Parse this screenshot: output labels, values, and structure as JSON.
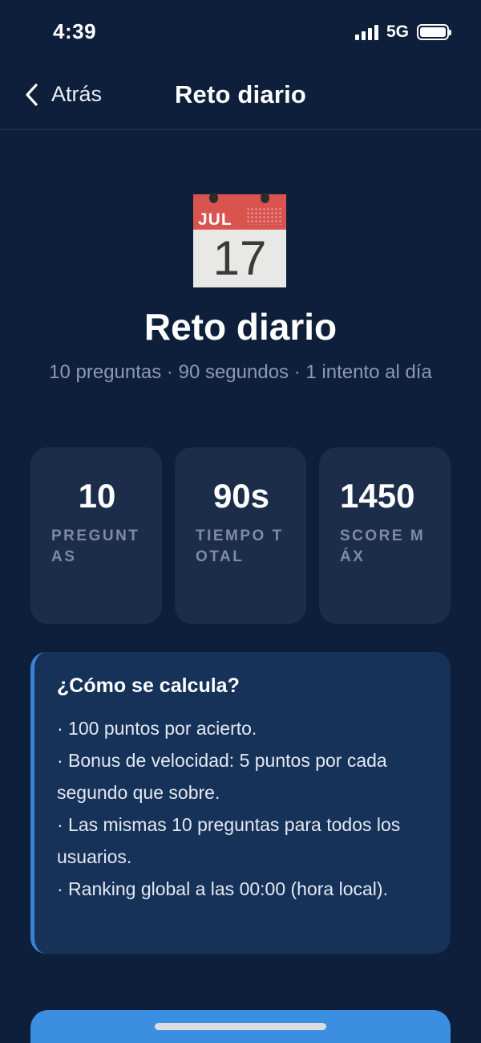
{
  "status_bar": {
    "time": "4:39",
    "network": "5G"
  },
  "nav": {
    "back_label": "Atrás",
    "title": "Reto diario"
  },
  "calendar": {
    "month": "JUL",
    "day": "17"
  },
  "hero": {
    "title": "Reto diario",
    "subtitle": "10 preguntas · 90 segundos · 1 intento al día"
  },
  "stats": [
    {
      "value": "10",
      "label": "PREGUNTAS"
    },
    {
      "value": "90s",
      "label": "TIEMPO TOTAL"
    },
    {
      "value": "1450",
      "label": "SCORE MÁX"
    }
  ],
  "info": {
    "title": "¿Cómo se calcula?",
    "lines": [
      "· 100 puntos por acierto.",
      "· Bonus de velocidad: 5 puntos por cada segundo que sobre.",
      "· Las mismas 10 preguntas para todos los usuarios.",
      "· Ranking global a las 00:00 (hora local)."
    ]
  },
  "colors": {
    "background": "#0e1f3b",
    "card": "#1b2d49",
    "info_card": "#173259",
    "accent": "#3b82d6",
    "button": "#3b8ee0"
  }
}
